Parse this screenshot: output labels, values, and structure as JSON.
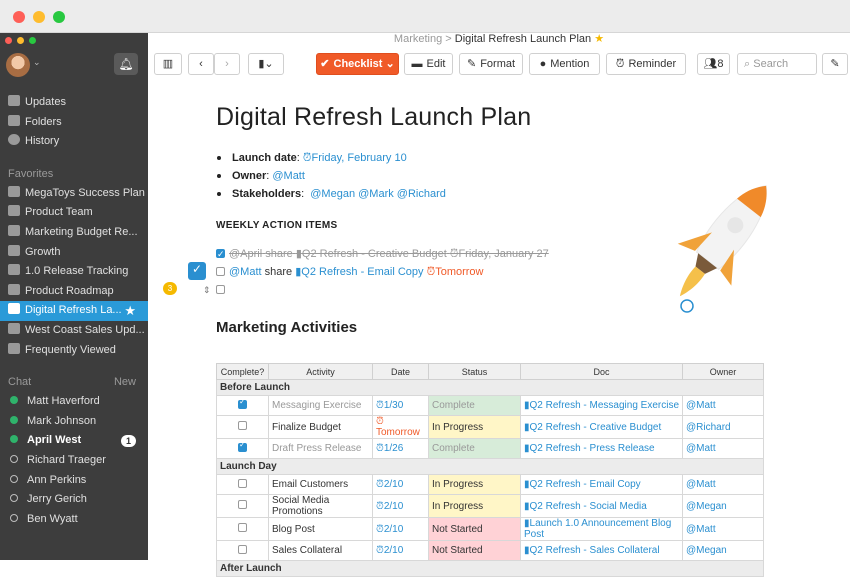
{
  "app": {
    "accent": "#2a9ad8",
    "sidebar_bg": "#3d3d3d",
    "checklist_color": "#f05a28"
  },
  "breadcrumb": {
    "parent": "Marketing",
    "separator": ">",
    "current": "Digital Refresh Launch Plan",
    "favorite_icon": "star-icon"
  },
  "sidebar": {
    "nav": [
      {
        "label": "Updates",
        "icon": "updates-icon"
      },
      {
        "label": "Folders",
        "icon": "folder-icon"
      },
      {
        "label": "History",
        "icon": "history-icon"
      }
    ],
    "favorites_label": "Favorites",
    "favorites": [
      {
        "label": "MegaToys Success Plan"
      },
      {
        "label": "Product Team"
      },
      {
        "label": "Marketing Budget Re..."
      },
      {
        "label": "Growth"
      },
      {
        "label": "1.0 Release Tracking"
      },
      {
        "label": "Product Roadmap"
      },
      {
        "label": "Digital Refresh La..."
      },
      {
        "label": "West Coast Sales Upd..."
      },
      {
        "label": "Frequently Viewed"
      }
    ],
    "chat_label": "Chat",
    "chat_new": "New",
    "chat": [
      {
        "name": "Matt Haverford",
        "online": true
      },
      {
        "name": "Mark Johnson",
        "online": true
      },
      {
        "name": "April West",
        "online": true,
        "unread": "1"
      },
      {
        "name": "Richard Traeger",
        "online": false
      },
      {
        "name": "Ann Perkins",
        "online": false
      },
      {
        "name": "Jerry Gerich",
        "online": false
      },
      {
        "name": "Ben Wyatt",
        "online": false
      }
    ]
  },
  "toolbar": {
    "checklist": "Checklist",
    "edit": "Edit",
    "format": "Format",
    "mention": "Mention",
    "reminder": "Reminder",
    "share_count": "8",
    "search_placeholder": "Search"
  },
  "doc": {
    "title": "Digital Refresh Launch Plan",
    "bullets": {
      "launch_label": "Launch date",
      "launch_value": "Friday, February 10",
      "owner_label": "Owner",
      "owner_value": "@Matt",
      "stakeholders_label": "Stakeholders",
      "stakeholders_value": "@Megan @Mark @Richard"
    },
    "weekly_heading": "WEEKLY ACTION ITEMS",
    "actions": [
      {
        "done": true,
        "who": "@April",
        "verb": "share",
        "doc": "Q2 Refresh - Creative Budget",
        "date": "Friday, January 27"
      },
      {
        "done": false,
        "who": "@Matt",
        "verb": "share",
        "doc": "Q2 Refresh - Email Copy",
        "date": "Tomorrow"
      }
    ],
    "side_badge": "3",
    "activities_heading": "Marketing Activities",
    "table": {
      "headers": [
        "Complete?",
        "Activity",
        "Date",
        "Status",
        "Doc",
        "Owner"
      ],
      "groups": [
        {
          "name": "Before Launch",
          "rows": [
            {
              "done": true,
              "activity": "Messaging Exercise",
              "date": "1/30",
              "status": "Complete",
              "doc": "Q2 Refresh - Messaging Exercise",
              "owner": "@Matt"
            },
            {
              "done": false,
              "activity": "Finalize Budget",
              "date": "Tomorrow",
              "status": "In Progress",
              "doc": "Q2 Refresh - Creative Budget",
              "owner": "@Richard"
            },
            {
              "done": true,
              "activity": "Draft Press Release",
              "date": "1/26",
              "status": "Complete",
              "doc": "Q2 Refresh - Press Release",
              "owner": "@Matt"
            }
          ]
        },
        {
          "name": "Launch Day",
          "rows": [
            {
              "done": false,
              "activity": "Email Customers",
              "date": "2/10",
              "status": "In Progress",
              "doc": "Q2 Refresh - Email Copy",
              "owner": "@Matt"
            },
            {
              "done": false,
              "activity": "Social Media Promotions",
              "date": "2/10",
              "status": "In Progress",
              "doc": "Q2 Refresh - Social Media",
              "owner": "@Megan"
            },
            {
              "done": false,
              "activity": "Blog Post",
              "date": "2/10",
              "status": "Not Started",
              "doc": "Launch 1.0 Announcement Blog Post",
              "owner": "@Matt"
            },
            {
              "done": false,
              "activity": "Sales Collateral",
              "date": "2/10",
              "status": "Not Started",
              "doc": "Q2 Refresh - Sales Collateral",
              "owner": "@Megan"
            }
          ]
        },
        {
          "name": "After Launch",
          "rows": []
        }
      ]
    }
  }
}
